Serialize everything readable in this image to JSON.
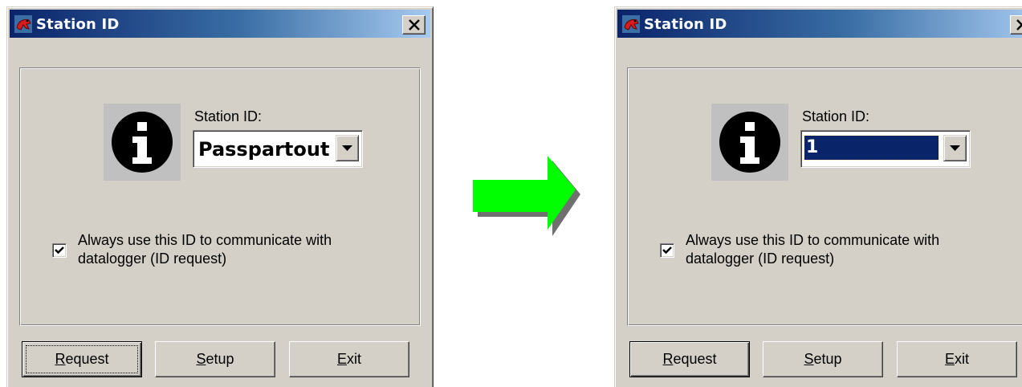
{
  "dialogs": [
    {
      "title": "Station ID",
      "station_label": "Station ID:",
      "station_value": "Passpartout",
      "checkbox_label_line1": "Always use this ID to communicate with",
      "checkbox_label_line2": "datalogger (ID request)",
      "checkbox_checked": true,
      "buttons": {
        "request": {
          "mnemonic": "R",
          "rest": "equest"
        },
        "setup": {
          "mnemonic": "S",
          "rest": "etup"
        },
        "exit": {
          "mnemonic": "E",
          "rest": "xit"
        }
      }
    },
    {
      "title": "Station ID",
      "station_label": "Station ID:",
      "station_value": "1",
      "checkbox_label_line1": "Always use this ID to communicate with",
      "checkbox_label_line2": "datalogger (ID request)",
      "checkbox_checked": true,
      "buttons": {
        "request": {
          "mnemonic": "R",
          "rest": "equest"
        },
        "setup": {
          "mnemonic": "S",
          "rest": "etup"
        },
        "exit": {
          "mnemonic": "E",
          "rest": "xit"
        }
      }
    }
  ],
  "icons": {
    "app": "frog-app-icon",
    "close": "close-icon",
    "info": "info-icon",
    "dropdown": "chevron-down-icon",
    "check": "checkmark-icon",
    "transition": "arrow-right-icon"
  },
  "colors": {
    "dialog_bg": "#d4d0c8",
    "titlebar_start": "#0a246a",
    "titlebar_end": "#a6caf0",
    "selection": "#0a246a",
    "arrow": "#00ff00"
  }
}
